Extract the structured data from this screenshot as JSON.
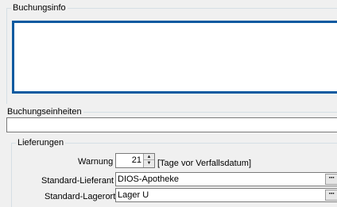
{
  "buchungsinfo": {
    "title": "Buchungsinfo",
    "value": ""
  },
  "buchungseinheiten": {
    "title": "Buchungseinheiten",
    "value": ""
  },
  "lieferungen": {
    "title": "Lieferungen",
    "warnung_label": "Warnung",
    "warnung_value": "21",
    "warnung_unit": "[Tage vor Verfallsdatum]",
    "lieferant_label": "Standard-Lieferant",
    "lieferant_value": "DIOS-Apotheke",
    "lagerort_label": "Standard-Lagerort",
    "lagerort_value": "Lager U",
    "ellipsis": "···"
  },
  "icons": {
    "spin_up": "▲",
    "spin_down": "▼"
  },
  "colors": {
    "focus_border": "#0a5aa0",
    "background": "#f0f0f0"
  }
}
